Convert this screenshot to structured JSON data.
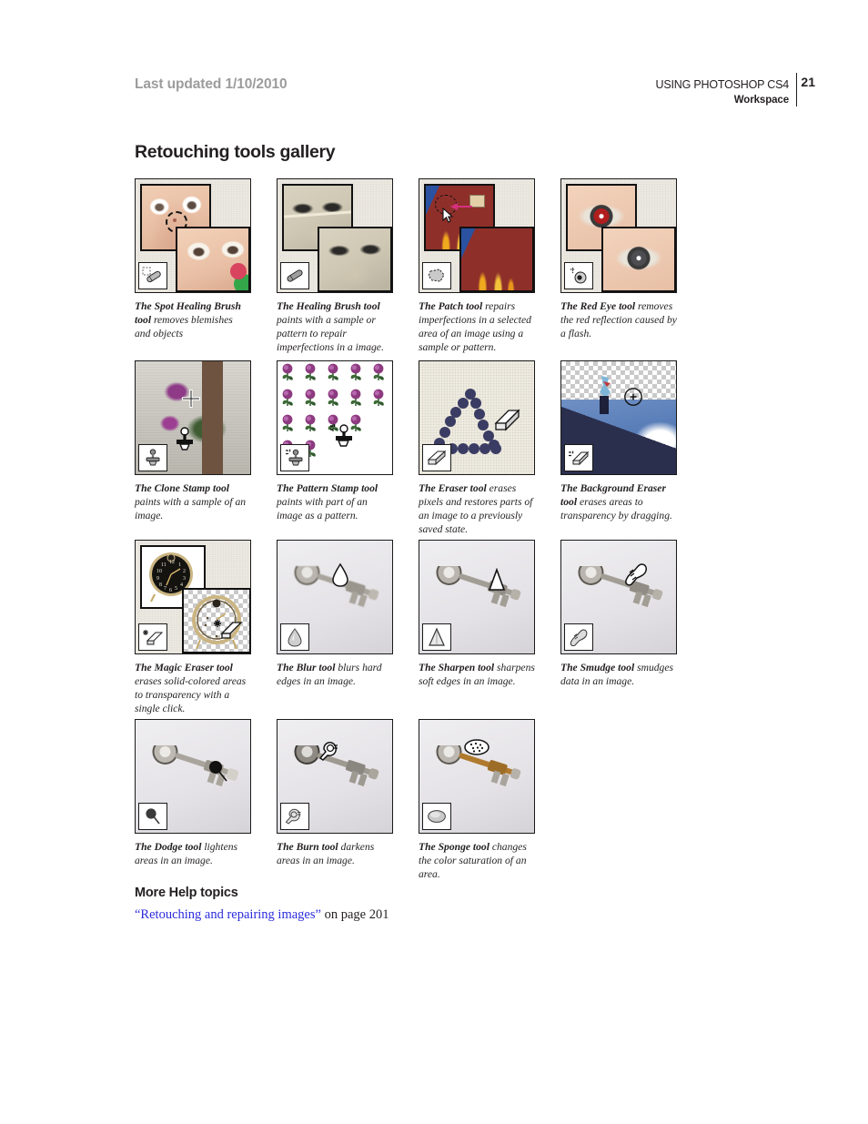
{
  "header": {
    "last_updated": "Last updated 1/10/2010",
    "doc_title": "USING PHOTOSHOP CS4",
    "section": "Workspace",
    "page_number": "21"
  },
  "page": {
    "section_title": "Retouching tools gallery",
    "more_help_title": "More Help topics",
    "more_help_link": "“Retouching and repairing images”",
    "more_help_suffix": " on page 201",
    "link_color": "#2b2bdd"
  },
  "gallery": {
    "rows": [
      {
        "cells": [
          {
            "tool_name": "The Spot Healing Brush tool",
            "description": " removes blemishes and objects",
            "icon": "spot-healing-brush-icon",
            "image": "baby-face-blemish-before-after"
          },
          {
            "tool_name": "The Healing Brush tool",
            "description": " paints with a sample or pattern to repair imperfections in a image.",
            "icon": "healing-brush-icon",
            "image": "baby-photo-scratch-before-after"
          },
          {
            "tool_name": "The Patch tool",
            "description": " repairs imperfections in a selected area of an image using a sample or pattern.",
            "icon": "patch-icon",
            "image": "red-car-flames-patch-selection"
          },
          {
            "tool_name": "The Red Eye tool",
            "description": " removes the red reflection caused by a flash.",
            "icon": "red-eye-icon",
            "image": "eye-red-reflection-before-after"
          }
        ]
      },
      {
        "cells": [
          {
            "tool_name": "The Clone Stamp tool",
            "description": " paints with a sample of an image.",
            "icon": "clone-stamp-icon",
            "image": "purple-flowers-clone-source"
          },
          {
            "tool_name": "The Pattern Stamp tool",
            "description": " paints with part of an image as a pattern.",
            "icon": "pattern-stamp-icon",
            "image": "repeating-rose-pattern"
          },
          {
            "tool_name": "The Eraser tool",
            "description": " erases pixels and restores parts of an image to a previously saved state.",
            "icon": "eraser-icon",
            "image": "dotted-triangle-erased"
          },
          {
            "tool_name": "The Background Eraser tool",
            "description": " erases areas to transparency by dragging.",
            "icon": "background-eraser-icon",
            "image": "totem-pole-sky-erased-transparent"
          }
        ]
      },
      {
        "cells": [
          {
            "tool_name": "The Magic Eraser tool",
            "description": " erases solid-colored areas to transparency with a single click.",
            "icon": "magic-eraser-icon",
            "image": "alarm-clock-face-erased-transparent"
          },
          {
            "tool_name": "The Blur tool",
            "description": " blurs hard edges in an image.",
            "icon": "blur-droplet-icon",
            "image": "antique-key-blurred"
          },
          {
            "tool_name": "The Sharpen tool",
            "description": " sharpens soft edges in an image.",
            "icon": "sharpen-triangle-icon",
            "image": "antique-key-sharpened"
          },
          {
            "tool_name": "The Smudge tool",
            "description": " smudges data in an image.",
            "icon": "smudge-finger-icon",
            "image": "antique-key-smudged"
          }
        ]
      },
      {
        "cells": [
          {
            "tool_name": "The Dodge tool",
            "description": " lightens areas in an image.",
            "icon": "dodge-icon",
            "image": "antique-key-dodged"
          },
          {
            "tool_name": "The Burn tool",
            "description": " darkens areas in an image.",
            "icon": "burn-hand-icon",
            "image": "antique-key-burned"
          },
          {
            "tool_name": "The Sponge tool",
            "description": " changes the color saturation of an area.",
            "icon": "sponge-icon",
            "image": "antique-key-saturated-gold"
          }
        ]
      }
    ]
  }
}
